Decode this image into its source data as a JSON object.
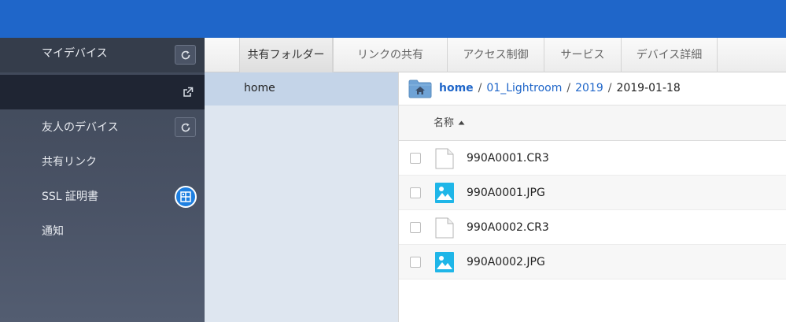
{
  "sidebar": {
    "items": [
      {
        "label": "マイデバイス",
        "refresh_icon": "refresh-icon"
      },
      {
        "label": "",
        "icon": "external-link-icon"
      },
      {
        "label": "友人のデバイス",
        "refresh_icon": "refresh-icon"
      },
      {
        "label": "共有リンク"
      },
      {
        "label": "SSL 証明書",
        "icon": "certificate-icon"
      },
      {
        "label": "通知"
      }
    ]
  },
  "tabs": [
    {
      "label": "共有フォルダー",
      "active": true
    },
    {
      "label": "リンクの共有"
    },
    {
      "label": "アクセス制御"
    },
    {
      "label": "サービス"
    },
    {
      "label": "デバイス詳細"
    }
  ],
  "folders": [
    {
      "label": "home",
      "selected": true
    }
  ],
  "breadcrumb": {
    "items": [
      "home",
      "01_Lightroom",
      "2019"
    ],
    "current": "2019-01-18",
    "separator": "/"
  },
  "file_table": {
    "column_name": "名称",
    "sort": "ascending",
    "rows": [
      {
        "name": "990A0001.CR3",
        "type": "file"
      },
      {
        "name": "990A0001.JPG",
        "type": "image"
      },
      {
        "name": "990A0002.CR3",
        "type": "file"
      },
      {
        "name": "990A0002.JPG",
        "type": "image"
      }
    ]
  },
  "colors": {
    "topbar": "#1f66c9",
    "sidebar": "#464f61",
    "selected_folder": "#c4d4e8",
    "link": "#1f66c9",
    "image_icon": "#1fb6e8"
  }
}
